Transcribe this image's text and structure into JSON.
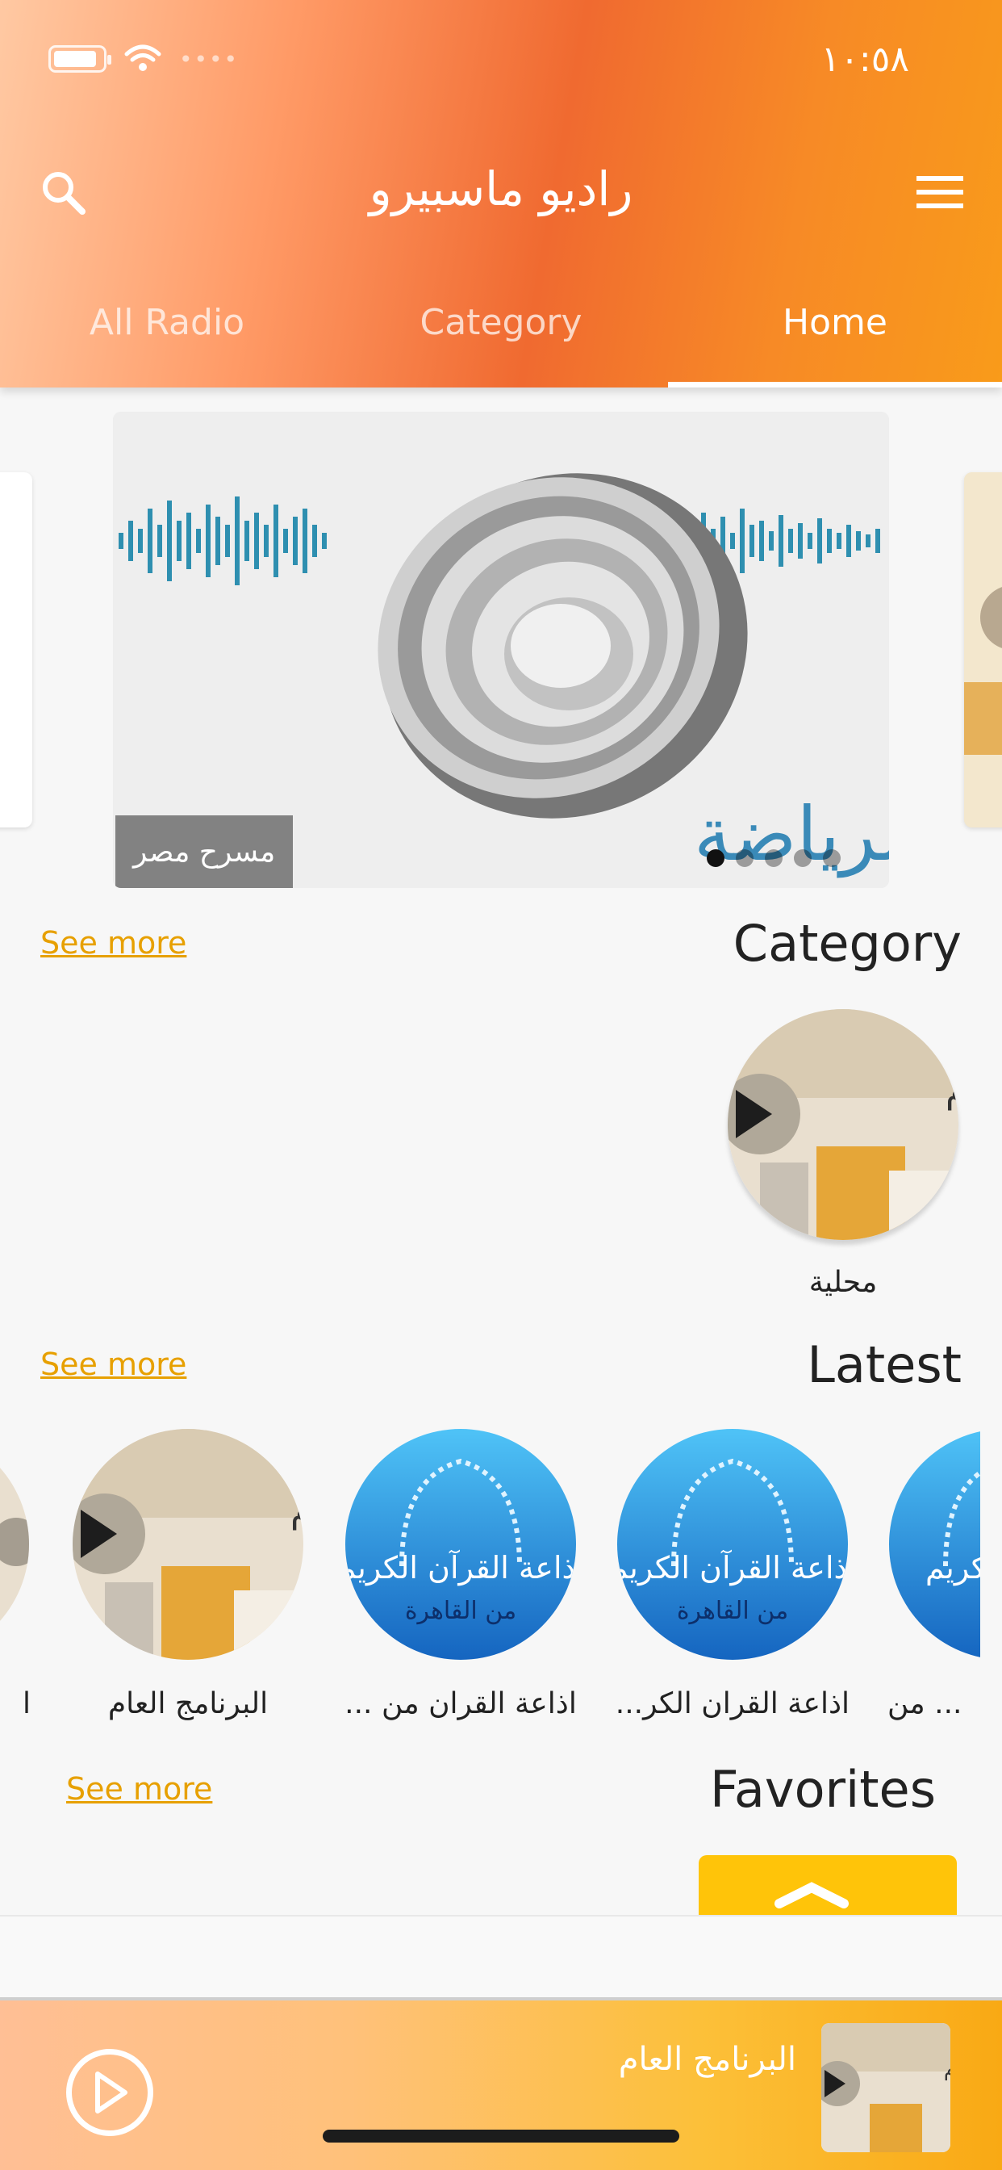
{
  "status_bar": {
    "time": "١٠:٥٨"
  },
  "header": {
    "title": "راديو ماسبيرو"
  },
  "tabs": [
    {
      "label": "All Radio"
    },
    {
      "label": "Category"
    },
    {
      "label": "Home"
    }
  ],
  "carousel": {
    "caption": "مسرح مصر",
    "image_text": "الشباب والرياضة",
    "dots_count": 5,
    "active_dot": 1
  },
  "category_section": {
    "title": "Category",
    "see_more": "See more",
    "items": [
      {
        "label": "محلية",
        "image_text": "برنامج العام"
      }
    ]
  },
  "latest_section": {
    "title": "Latest",
    "see_more": "See more",
    "items": [
      {
        "label": "ا"
      },
      {
        "label": "البرنامج العام",
        "image_text": "برنامج العام"
      },
      {
        "label": "اذاعة القران من ...",
        "image_line1": "إذاعة القرآن الكريم",
        "image_line2": "من القاهرة"
      },
      {
        "label": "اذاعة القران الكر...",
        "image_line1": "إذاعة القرآن الكريم",
        "image_line2": "من القاهرة"
      },
      {
        "label": "... من",
        "image_line1": "الكريم"
      }
    ]
  },
  "favorites_section": {
    "title": "Favorites",
    "see_more": "See more"
  },
  "player": {
    "now_playing": "البرنامج العام",
    "thumb_text": "برنامج العام"
  },
  "colors": {
    "accent": "#f37a2a",
    "link": "#e7a000",
    "player_yellow": "#fcc039",
    "quran_blue": "#1e8fe0"
  }
}
